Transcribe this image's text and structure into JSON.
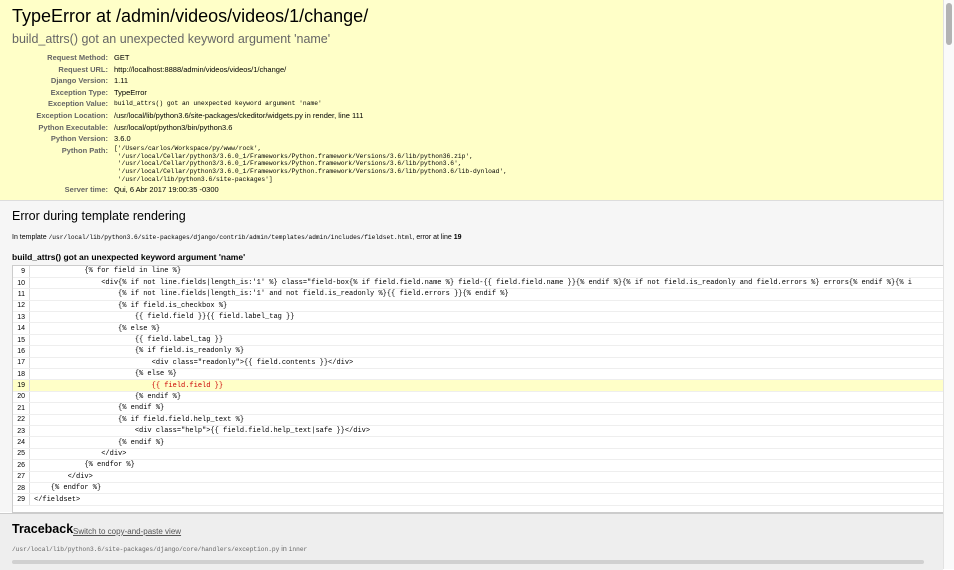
{
  "summary": {
    "title": "TypeError at /admin/videos/videos/1/change/",
    "subtitle": "build_attrs() got an unexpected keyword argument 'name'",
    "meta": [
      {
        "label": "Request Method:",
        "value": "GET"
      },
      {
        "label": "Request URL:",
        "value": "http://localhost:8888/admin/videos/videos/1/change/"
      },
      {
        "label": "Django Version:",
        "value": "1.11"
      },
      {
        "label": "Exception Type:",
        "value": "TypeError"
      },
      {
        "label": "Exception Value:",
        "value": "build_attrs() got an unexpected keyword argument 'name'"
      },
      {
        "label": "Exception Location:",
        "value": "/usr/local/lib/python3.6/site-packages/ckeditor/widgets.py in render, line 111"
      },
      {
        "label": "Python Executable:",
        "value": "/usr/local/opt/python3/bin/python3.6"
      },
      {
        "label": "Python Version:",
        "value": "3.6.0"
      },
      {
        "label": "Python Path:",
        "lines": [
          "['/Users/carlos/Workspace/py/www/rock',",
          " '/usr/local/Cellar/python3/3.6.0_1/Frameworks/Python.framework/Versions/3.6/lib/python36.zip',",
          " '/usr/local/Cellar/python3/3.6.0_1/Frameworks/Python.framework/Versions/3.6/lib/python3.6',",
          " '/usr/local/Cellar/python3/3.6.0_1/Frameworks/Python.framework/Versions/3.6/lib/python3.6/lib-dynload',",
          " '/usr/local/lib/python3.6/site-packages']"
        ]
      },
      {
        "label": "Server time:",
        "value": "Qui, 6 Abr 2017 19:00:35 -0300"
      }
    ]
  },
  "template": {
    "heading": "Error during template rendering",
    "in_template_prefix": "In template",
    "template_path": "/usr/local/lib/python3.6/site-packages/django/contrib/admin/templates/admin/includes/fieldset.html",
    "error_at_line_text": ", error at line",
    "error_line": "19",
    "error_message": "build_attrs() got an unexpected keyword argument 'name'",
    "highlight_line": 19,
    "lines": [
      {
        "n": "9",
        "src": "            {% for field in line %}"
      },
      {
        "n": "10",
        "src": "                <div{% if not line.fields|length_is:'1' %} class=\"field-box{% if field.field.name %} field-{{ field.field.name }}{% endif %}{% if not field.is_readonly and field.errors %} errors{% endif %}{% i"
      },
      {
        "n": "11",
        "src": "                    {% if not line.fields|length_is:'1' and not field.is_readonly %}{{ field.errors }}{% endif %}"
      },
      {
        "n": "12",
        "src": "                    {% if field.is_checkbox %}"
      },
      {
        "n": "13",
        "src": "                        {{ field.field }}{{ field.label_tag }}"
      },
      {
        "n": "14",
        "src": "                    {% else %}"
      },
      {
        "n": "15",
        "src": "                        {{ field.label_tag }}"
      },
      {
        "n": "16",
        "src": "                        {% if field.is_readonly %}"
      },
      {
        "n": "17",
        "src": "                            <div class=\"readonly\">{{ field.contents }}</div>"
      },
      {
        "n": "18",
        "src": "                        {% else %}"
      },
      {
        "n": "19",
        "src": "                            {{ field.field }}"
      },
      {
        "n": "20",
        "src": "                        {% endif %}"
      },
      {
        "n": "21",
        "src": "                    {% endif %}"
      },
      {
        "n": "22",
        "src": "                    {% if field.field.help_text %}"
      },
      {
        "n": "23",
        "src": "                        <div class=\"help\">{{ field.field.help_text|safe }}</div>"
      },
      {
        "n": "24",
        "src": "                    {% endif %}"
      },
      {
        "n": "25",
        "src": "                </div>"
      },
      {
        "n": "26",
        "src": "            {% endfor %}"
      },
      {
        "n": "27",
        "src": "        </div>"
      },
      {
        "n": "28",
        "src": "    {% endfor %}"
      },
      {
        "n": "29",
        "src": "</fieldset>"
      }
    ]
  },
  "traceback": {
    "heading": "Traceback",
    "switch_link": "Switch to copy-and-paste view",
    "frame_file": "/usr/local/lib/python3.6/site-packages/django/core/handlers/exception.py",
    "frame_in": "in",
    "frame_func": "inner"
  }
}
